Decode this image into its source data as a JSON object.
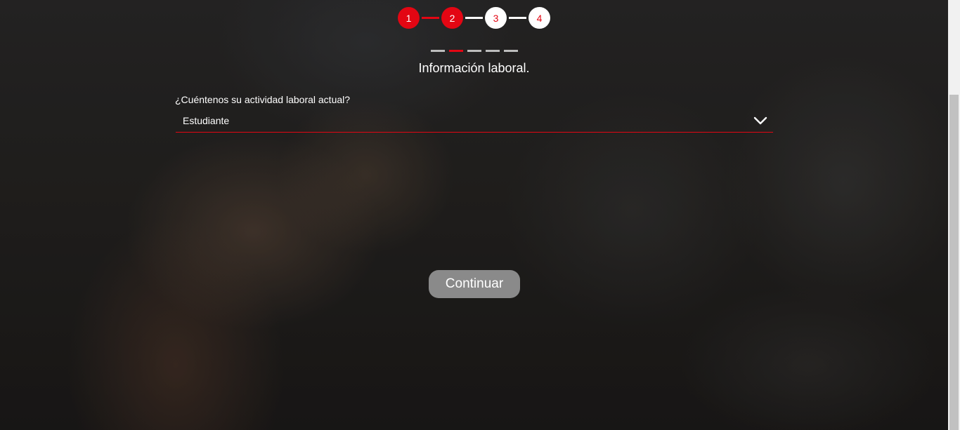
{
  "stepper": {
    "steps": [
      {
        "label": "1",
        "state": "done"
      },
      {
        "label": "2",
        "state": "done"
      },
      {
        "label": "3",
        "state": "todo"
      },
      {
        "label": "4",
        "state": "todo"
      }
    ],
    "connector_colors": [
      "#e30613",
      "#ffffff",
      "#ffffff"
    ]
  },
  "sub_progress": {
    "total": 5,
    "current": 2,
    "active_color": "#e30613",
    "inactive_color": "#bdbdbd"
  },
  "section": {
    "title": "Información laboral."
  },
  "form": {
    "activity_label": "¿Cuéntenos su actividad laboral actual?",
    "activity_value": "Estudiante",
    "activity_icon": "chevron-down-icon"
  },
  "actions": {
    "continue_label": "Continuar"
  },
  "colors": {
    "accent": "#e30613",
    "button_disabled": "#8a8a8a"
  }
}
